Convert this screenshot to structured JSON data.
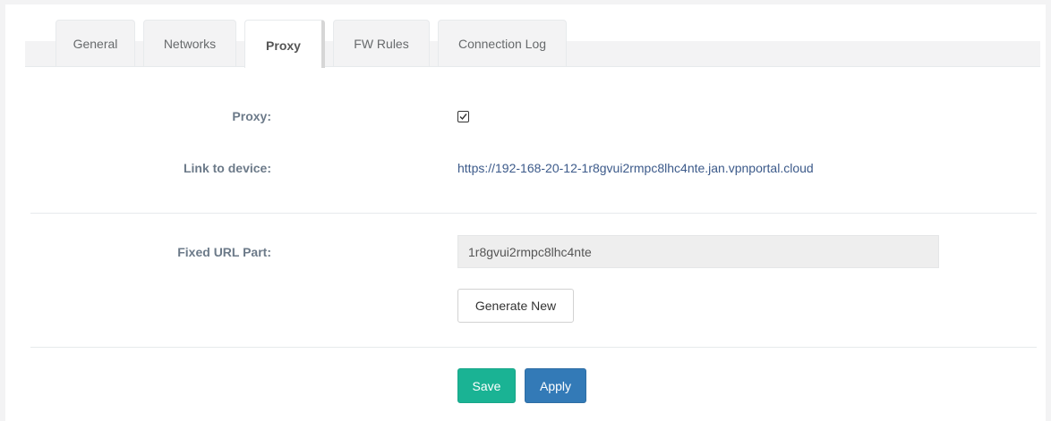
{
  "tabs": [
    {
      "label": "General",
      "active": false
    },
    {
      "label": "Networks",
      "active": false
    },
    {
      "label": "Proxy",
      "active": true
    },
    {
      "label": "FW Rules",
      "active": false
    },
    {
      "label": "Connection Log",
      "active": false
    }
  ],
  "form": {
    "proxy_label": "Proxy:",
    "proxy_checked": true,
    "link_label": "Link to device:",
    "link_value": "https://192-168-20-12-1r8gvui2rmpc8lhc4nte.jan.vpnportal.cloud",
    "fixed_url_label": "Fixed URL Part:",
    "fixed_url_value": "1r8gvui2rmpc8lhc4nte",
    "generate_button": "Generate New"
  },
  "actions": {
    "save_label": "Save",
    "apply_label": "Apply"
  },
  "colors": {
    "save": "#1ab394",
    "apply": "#337ab7",
    "label": "#6c7a89",
    "link": "#3c5a8a"
  }
}
